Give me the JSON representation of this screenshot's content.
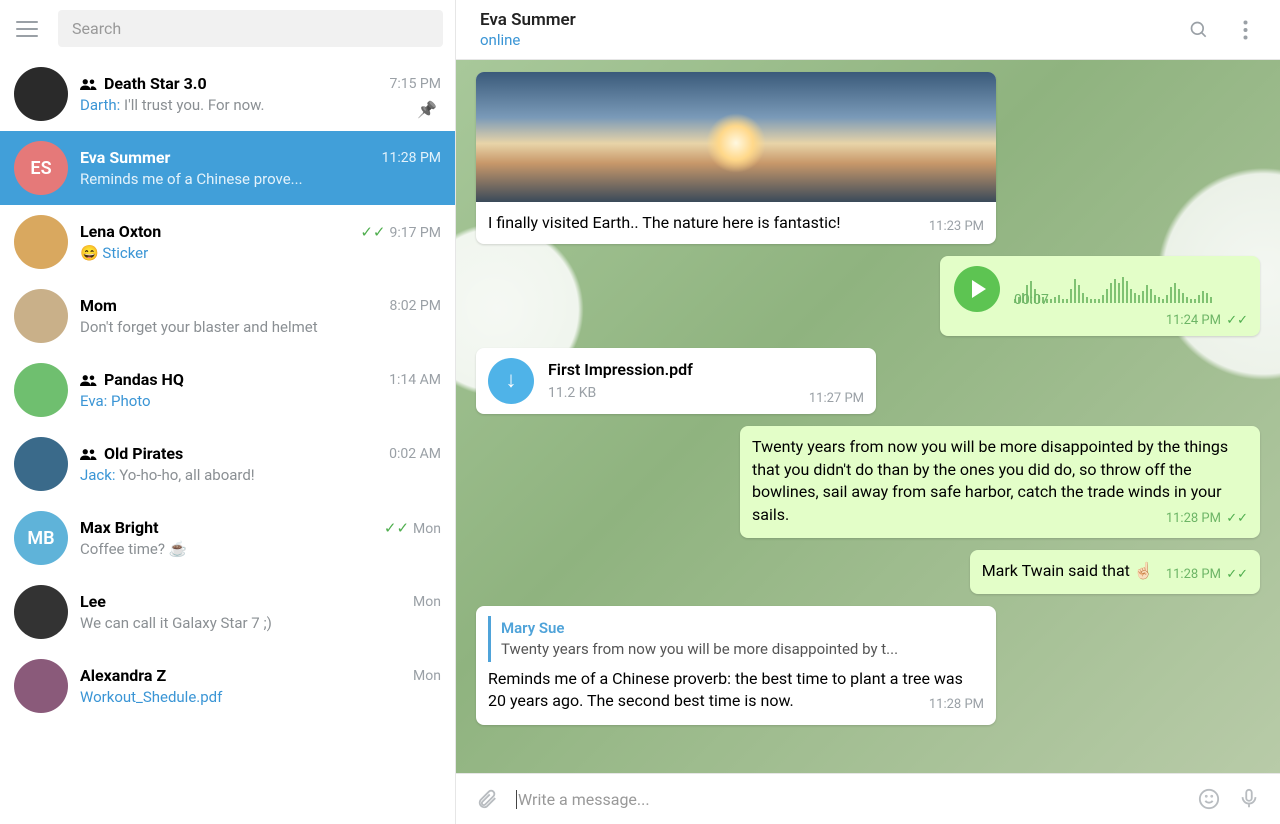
{
  "search": {
    "placeholder": "Search"
  },
  "chats": [
    {
      "name": "Death Star 3.0",
      "time": "7:15 PM",
      "sender": "Darth:",
      "preview": " I'll trust you. For now.",
      "group": true,
      "pinned": true,
      "avatar_bg": "#2a2a2a",
      "initials": ""
    },
    {
      "name": "Eva Summer",
      "time": "11:28 PM",
      "preview": "Reminds me of a Chinese prove...",
      "active": true,
      "avatar_bg": "#e57979",
      "initials": "ES"
    },
    {
      "name": "Lena Oxton",
      "time": "9:17 PM",
      "preview_emoji": "😄",
      "preview": " Sticker",
      "checks": true,
      "avatar_bg": "#d9a85f",
      "preview_color": "#3a95d5"
    },
    {
      "name": "Mom",
      "time": "8:02 PM",
      "preview": "Don't forget your blaster and helmet",
      "avatar_bg": "#c9b089"
    },
    {
      "name": "Pandas HQ",
      "time": "1:14 AM",
      "sender": "Eva:",
      "preview": " Photo",
      "group": true,
      "avatar_bg": "#6fbf6f",
      "preview_color": "#3a95d5"
    },
    {
      "name": "Old Pirates",
      "time": "0:02 AM",
      "sender": "Jack:",
      "preview": " Yo-ho-ho, all aboard!",
      "group": true,
      "avatar_bg": "#3a6a8a"
    },
    {
      "name": "Max Bright",
      "time": "Mon",
      "preview": "Coffee time? ☕",
      "checks": true,
      "avatar_bg": "#5fb3d9",
      "initials": "MB"
    },
    {
      "name": "Lee",
      "time": "Mon",
      "preview": "We can call it Galaxy Star 7 ;)",
      "avatar_bg": "#333"
    },
    {
      "name": "Alexandra Z",
      "time": "Mon",
      "preview": "Workout_Shedule.pdf",
      "avatar_bg": "#8a5a7a",
      "preview_color": "#3a95d5"
    }
  ],
  "header": {
    "name": "Eva Summer",
    "status": "online"
  },
  "messages": {
    "photo": {
      "caption": "I finally visited Earth.. The nature here is fantastic!",
      "time": "11:23 PM"
    },
    "voice": {
      "duration": "00:07",
      "time": "11:24 PM"
    },
    "file": {
      "name": "First Impression.pdf",
      "size": "11.2 KB",
      "time": "11:27 PM"
    },
    "quote": {
      "text": "Twenty years from now you will be more disappointed by the things that you didn't do than by the ones you did do, so throw off the bowlines, sail away from safe harbor, catch the trade winds in your sails.",
      "time": "11:28 PM"
    },
    "twain": {
      "text": "Mark Twain said that ☝🏻",
      "time": "11:28 PM"
    },
    "reply": {
      "reply_name": "Mary Sue",
      "reply_text": "Twenty years from now you will be more disappointed by t...",
      "text": "Reminds me of a Chinese proverb: the best time to plant a tree was 20 years ago. The second best time is now.",
      "time": "11:28 PM"
    }
  },
  "composer": {
    "placeholder": "Write a message..."
  }
}
